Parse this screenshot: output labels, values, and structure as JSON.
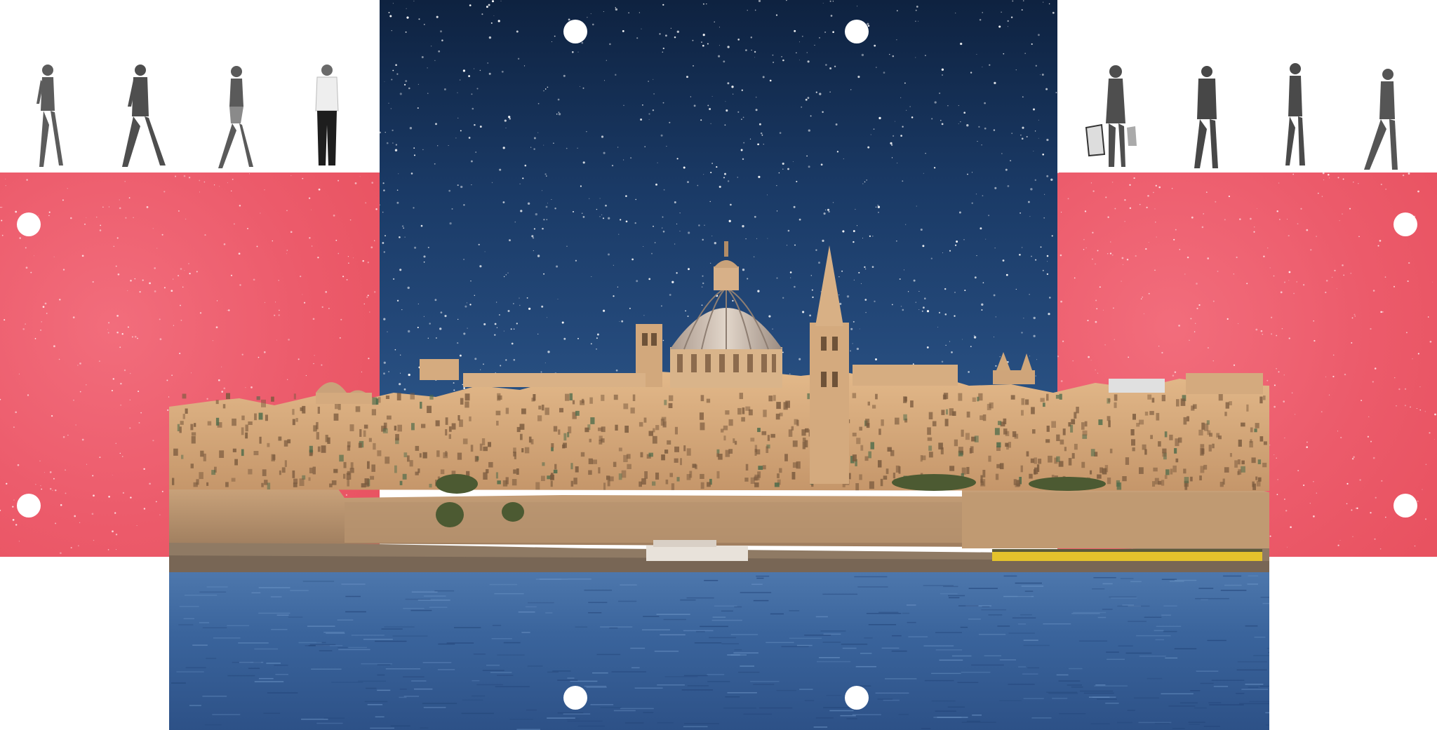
{
  "scene": {
    "description_colors": {
      "background": "#ffffff",
      "pink_panel": "#ec5b6b",
      "night_sky": "#16335c",
      "sea": "#3b66a0",
      "limestone": "#d9ad7c"
    },
    "icons": [
      "walking-woman-icon",
      "walking-man-icon",
      "walking-woman-icon",
      "standing-man-icon",
      "woman-with-shopping-bags-icon",
      "walking-man-icon",
      "walking-woman-icon",
      "walking-man-icon"
    ]
  }
}
